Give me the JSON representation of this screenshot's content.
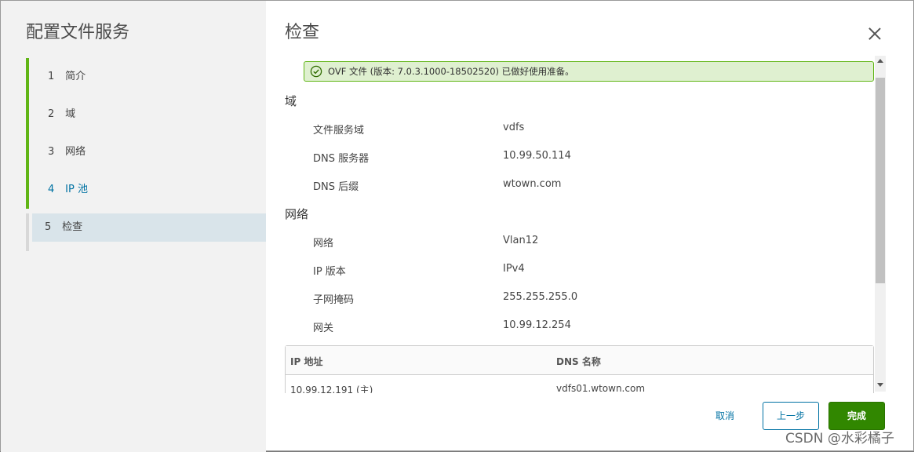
{
  "wizard": {
    "title": "配置文件服务",
    "steps": [
      {
        "num": "1",
        "label": "简介"
      },
      {
        "num": "2",
        "label": "域"
      },
      {
        "num": "3",
        "label": "网络"
      },
      {
        "num": "4",
        "label": "IP 池"
      },
      {
        "num": "5",
        "label": "检查"
      }
    ]
  },
  "page": {
    "title": "检查",
    "alert": "OVF 文件 (版本: 7.0.3.1000-18502520) 已做好使用准备。",
    "domain_section": {
      "title": "域",
      "rows": [
        {
          "label": "文件服务域",
          "value": "vdfs"
        },
        {
          "label": "DNS 服务器",
          "value": "10.99.50.114"
        },
        {
          "label": "DNS 后缀",
          "value": "wtown.com"
        }
      ]
    },
    "network_section": {
      "title": "网络",
      "rows": [
        {
          "label": "网络",
          "value": "Vlan12"
        },
        {
          "label": "IP 版本",
          "value": "IPv4"
        },
        {
          "label": "子网掩码",
          "value": "255.255.255.0"
        },
        {
          "label": "网关",
          "value": "10.99.12.254"
        }
      ]
    },
    "ip_table": {
      "headers": [
        "IP 地址",
        "DNS 名称"
      ],
      "rows": [
        [
          "10.99.12.191 (主)",
          "vdfs01.wtown.com"
        ]
      ]
    }
  },
  "footer": {
    "cancel_label": "取消",
    "back_label": "上一步",
    "finish_label": "完成"
  },
  "watermark": "CSDN @水彩橘子",
  "colors": {
    "accent_green": "#60b515",
    "link_blue": "#0072a3",
    "finish_button": "#318700",
    "alert_bg": "#dff0d0"
  }
}
